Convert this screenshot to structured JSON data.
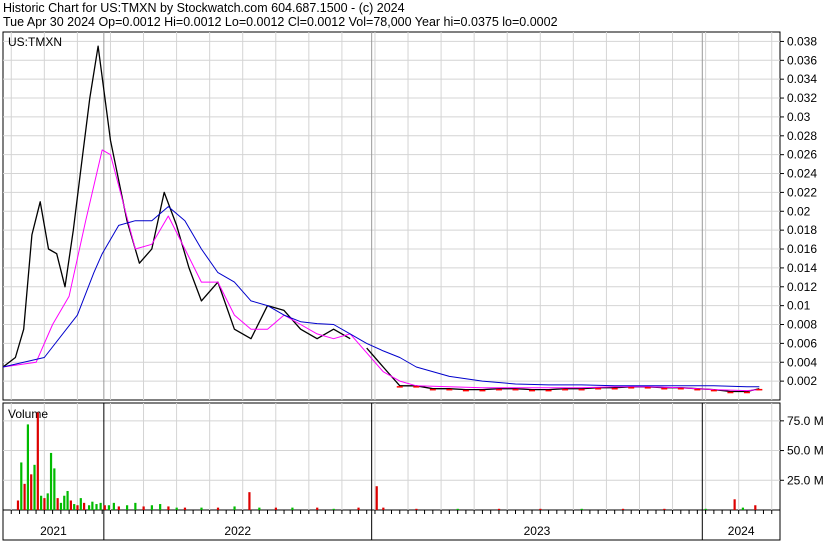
{
  "header": {
    "line1": "Historic Chart for US:TMXN by Stockwatch.com 604.687.1500 - (c) 2024",
    "line2": "Tue Apr 30 2024   Op=0.0012   Hi=0.0012   Lo=0.0012   Cl=0.0012   Vol=78,000   Year hi=0.0375   lo=0.0002"
  },
  "chart_data": [
    {
      "type": "line",
      "title": "US:TMXN",
      "x_labels": [
        "2021",
        "2022",
        "2023",
        "2024"
      ],
      "ylim": [
        0,
        0.039
      ],
      "yticks": [
        0.002,
        0.004,
        0.006,
        0.008,
        0.01,
        0.012,
        0.014,
        0.016,
        0.018,
        0.02,
        0.022,
        0.024,
        0.026,
        0.028,
        0.03,
        0.032,
        0.034,
        0.036,
        0.038
      ],
      "grid": true,
      "colors": {
        "price": "#000000",
        "ma_short": "#ff00ff",
        "ma_long": "#0000cc",
        "low_marks": "#ff0000"
      },
      "series": [
        {
          "key": "price",
          "x": [
            0,
            1.5,
            2.5,
            3.5,
            4.5,
            5.5,
            6.5,
            7.5,
            8.5,
            9.5,
            10.5,
            11.5,
            13,
            15,
            16.5,
            18,
            19.5,
            21,
            22.5,
            24,
            26,
            28,
            30,
            32,
            34,
            36,
            38,
            40,
            42
          ],
          "y": [
            0.0035,
            0.0045,
            0.0075,
            0.0175,
            0.021,
            0.016,
            0.0155,
            0.012,
            0.018,
            0.025,
            0.032,
            0.0375,
            0.0275,
            0.019,
            0.0145,
            0.016,
            0.022,
            0.0185,
            0.014,
            0.0105,
            0.0125,
            0.0075,
            0.0065,
            0.01,
            0.0095,
            0.0075,
            0.0065,
            0.0075,
            0.0065
          ]
        },
        {
          "key": "price",
          "x": [
            44,
            46,
            48,
            50,
            52,
            54,
            56,
            58,
            60,
            62,
            64,
            66,
            68,
            70,
            72,
            74,
            76,
            78,
            80,
            82,
            84,
            86,
            88,
            90,
            91.5
          ],
          "y": [
            0.0055,
            0.0035,
            0.0015,
            0.0015,
            0.0012,
            0.0012,
            0.0011,
            0.0011,
            0.0012,
            0.0012,
            0.0011,
            0.0011,
            0.0012,
            0.0012,
            0.0013,
            0.0013,
            0.0014,
            0.0014,
            0.0013,
            0.0013,
            0.0012,
            0.0011,
            0.0009,
            0.0009,
            0.0012
          ]
        },
        {
          "key": "ma_short",
          "x": [
            0,
            4,
            6,
            8,
            10,
            12,
            13,
            14.5,
            16,
            18,
            20,
            22,
            24,
            26,
            28,
            30,
            32,
            34,
            36,
            38,
            40,
            42,
            44,
            46,
            48,
            50,
            54,
            58,
            62,
            66,
            70,
            74,
            78,
            82,
            86,
            90,
            91.5
          ],
          "y": [
            0.0035,
            0.004,
            0.008,
            0.011,
            0.019,
            0.0265,
            0.026,
            0.021,
            0.016,
            0.0165,
            0.0195,
            0.016,
            0.0125,
            0.0125,
            0.009,
            0.0075,
            0.0075,
            0.009,
            0.008,
            0.007,
            0.0065,
            0.007,
            0.005,
            0.003,
            0.002,
            0.0015,
            0.0014,
            0.0013,
            0.0013,
            0.0013,
            0.0013,
            0.0014,
            0.0014,
            0.0013,
            0.0011,
            0.001,
            0.0011
          ]
        },
        {
          "key": "ma_long",
          "x": [
            0,
            5,
            9,
            11,
            12,
            14,
            16,
            18,
            20,
            22,
            24,
            26,
            28,
            30,
            32,
            34,
            36,
            38,
            40,
            42,
            44,
            46,
            48,
            50,
            54,
            58,
            62,
            66,
            70,
            74,
            78,
            82,
            86,
            90,
            91.5
          ],
          "y": [
            0.0035,
            0.0045,
            0.009,
            0.0135,
            0.0155,
            0.0185,
            0.019,
            0.019,
            0.0205,
            0.019,
            0.016,
            0.0135,
            0.0125,
            0.0105,
            0.01,
            0.009,
            0.0083,
            0.0081,
            0.008,
            0.007,
            0.006,
            0.0052,
            0.0045,
            0.0035,
            0.0025,
            0.002,
            0.0017,
            0.0016,
            0.0016,
            0.0015,
            0.0015,
            0.0015,
            0.0015,
            0.0014,
            0.0014
          ]
        }
      ]
    },
    {
      "type": "bar",
      "title": "Volume",
      "ylim": [
        0,
        90
      ],
      "yticks": [
        25,
        50,
        75
      ],
      "ytick_labels": [
        "25.0 M",
        "50.0 M",
        "75.0 M"
      ],
      "colors": {
        "up": "#00bb00",
        "down": "#dd0000"
      },
      "bars": [
        {
          "x": 1.8,
          "value": 8,
          "color": "down"
        },
        {
          "x": 2.2,
          "value": 40,
          "color": "up"
        },
        {
          "x": 2.6,
          "value": 22,
          "color": "down"
        },
        {
          "x": 3.0,
          "value": 72,
          "color": "up"
        },
        {
          "x": 3.4,
          "value": 30,
          "color": "down"
        },
        {
          "x": 3.8,
          "value": 38,
          "color": "up"
        },
        {
          "x": 4.2,
          "value": 82,
          "color": "down"
        },
        {
          "x": 4.6,
          "value": 12,
          "color": "up"
        },
        {
          "x": 5.0,
          "value": 10,
          "color": "down"
        },
        {
          "x": 5.4,
          "value": 14,
          "color": "up"
        },
        {
          "x": 5.8,
          "value": 48,
          "color": "up"
        },
        {
          "x": 6.2,
          "value": 35,
          "color": "up"
        },
        {
          "x": 6.6,
          "value": 10,
          "color": "down"
        },
        {
          "x": 7.0,
          "value": 6,
          "color": "up"
        },
        {
          "x": 7.4,
          "value": 12,
          "color": "up"
        },
        {
          "x": 7.8,
          "value": 16,
          "color": "up"
        },
        {
          "x": 8.2,
          "value": 8,
          "color": "down"
        },
        {
          "x": 8.6,
          "value": 5,
          "color": "up"
        },
        {
          "x": 9.0,
          "value": 4,
          "color": "down"
        },
        {
          "x": 9.4,
          "value": 10,
          "color": "up"
        },
        {
          "x": 9.8,
          "value": 6,
          "color": "down"
        },
        {
          "x": 10.4,
          "value": 4,
          "color": "up"
        },
        {
          "x": 10.8,
          "value": 7,
          "color": "up"
        },
        {
          "x": 11.3,
          "value": 5,
          "color": "up"
        },
        {
          "x": 11.8,
          "value": 6,
          "color": "up"
        },
        {
          "x": 12.3,
          "value": 4,
          "color": "down"
        },
        {
          "x": 12.8,
          "value": 4,
          "color": "up"
        },
        {
          "x": 13.4,
          "value": 6,
          "color": "up"
        },
        {
          "x": 14.0,
          "value": 3,
          "color": "down"
        },
        {
          "x": 15.0,
          "value": 4,
          "color": "up"
        },
        {
          "x": 16.0,
          "value": 6,
          "color": "up"
        },
        {
          "x": 17.0,
          "value": 3,
          "color": "down"
        },
        {
          "x": 18.0,
          "value": 4,
          "color": "up"
        },
        {
          "x": 19.0,
          "value": 5,
          "color": "up"
        },
        {
          "x": 20.0,
          "value": 3,
          "color": "down"
        },
        {
          "x": 21.0,
          "value": 2,
          "color": "up"
        },
        {
          "x": 22.0,
          "value": 2,
          "color": "down"
        },
        {
          "x": 24.0,
          "value": 2,
          "color": "up"
        },
        {
          "x": 26.0,
          "value": 2,
          "color": "down"
        },
        {
          "x": 28.0,
          "value": 3,
          "color": "up"
        },
        {
          "x": 29.8,
          "value": 15,
          "color": "down"
        },
        {
          "x": 31.0,
          "value": 2,
          "color": "up"
        },
        {
          "x": 33.0,
          "value": 2,
          "color": "down"
        },
        {
          "x": 35.0,
          "value": 2,
          "color": "up"
        },
        {
          "x": 38.0,
          "value": 2,
          "color": "down"
        },
        {
          "x": 40.0,
          "value": 1,
          "color": "up"
        },
        {
          "x": 43.0,
          "value": 2,
          "color": "down"
        },
        {
          "x": 45.2,
          "value": 20,
          "color": "down"
        },
        {
          "x": 46.0,
          "value": 2,
          "color": "down"
        },
        {
          "x": 50.0,
          "value": 1,
          "color": "down"
        },
        {
          "x": 55.0,
          "value": 1,
          "color": "up"
        },
        {
          "x": 60.0,
          "value": 1,
          "color": "down"
        },
        {
          "x": 65.0,
          "value": 1,
          "color": "down"
        },
        {
          "x": 70.0,
          "value": 1,
          "color": "up"
        },
        {
          "x": 75.0,
          "value": 1,
          "color": "down"
        },
        {
          "x": 80.0,
          "value": 1,
          "color": "down"
        },
        {
          "x": 85.0,
          "value": 1,
          "color": "up"
        },
        {
          "x": 88.5,
          "value": 9,
          "color": "down"
        },
        {
          "x": 89.5,
          "value": 2,
          "color": "up"
        },
        {
          "x": 91.0,
          "value": 4,
          "color": "down"
        }
      ]
    }
  ]
}
